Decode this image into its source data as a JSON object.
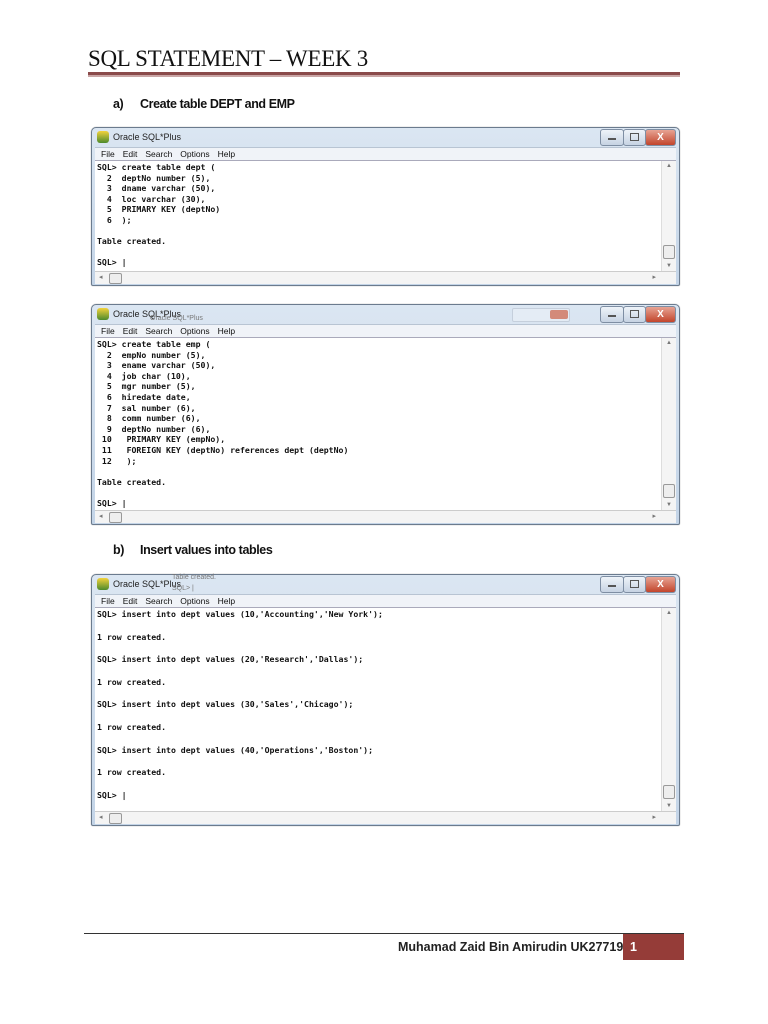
{
  "document": {
    "title": "SQL STATEMENT – WEEK 3",
    "sections": [
      {
        "label": "a)",
        "text": "Create table DEPT and EMP"
      },
      {
        "label": "b)",
        "text": "Insert values into tables"
      }
    ],
    "footer": {
      "author": "Muhamad Zaid Bin Amirudin UK27719",
      "page": "1"
    }
  },
  "windows": [
    {
      "title": "Oracle SQL*Plus",
      "close_glyph": "X",
      "menu": [
        "File",
        "Edit",
        "Search",
        "Options",
        "Help"
      ],
      "lines": [
        "SQL> create table dept (",
        "  2  deptNo number (5),",
        "  3  dname varchar (50),",
        "  4  loc varchar (30),",
        "  5  PRIMARY KEY (deptNo)",
        "  6  );",
        "",
        "Table created.",
        "",
        "SQL> |"
      ]
    },
    {
      "title": "Oracle SQL*Plus",
      "ghost_title": "Oracle SQL*Plus",
      "close_glyph": "X",
      "menu": [
        "File",
        "Edit",
        "Search",
        "Options",
        "Help"
      ],
      "lines": [
        "SQL> create table emp (",
        "  2  empNo number (5),",
        "  3  ename varchar (50),",
        "  4  job char (10),",
        "  5  mgr number (5),",
        "  6  hiredate date,",
        "  7  sal number (6),",
        "  8  comm number (6),",
        "  9  deptNo number (6),",
        " 10   PRIMARY KEY (empNo),",
        " 11   FOREIGN KEY (deptNo) references dept (deptNo)",
        " 12   );",
        "",
        "Table created.",
        "",
        "SQL> |"
      ]
    },
    {
      "title": "Oracle SQL*Plus",
      "ghost_lines": [
        "Table created.",
        "SQL> |"
      ],
      "close_glyph": "X",
      "menu": [
        "File",
        "Edit",
        "Search",
        "Options",
        "Help"
      ],
      "lines": [
        "SQL> insert into dept values (10,'Accounting','New York');",
        "",
        "1 row created.",
        "",
        "SQL> insert into dept values (20,'Research','Dallas');",
        "",
        "1 row created.",
        "",
        "SQL> insert into dept values (30,'Sales','Chicago');",
        "",
        "1 row created.",
        "",
        "SQL> insert into dept values (40,'Operations','Boston');",
        "",
        "1 row created.",
        "",
        "SQL> |"
      ]
    }
  ]
}
